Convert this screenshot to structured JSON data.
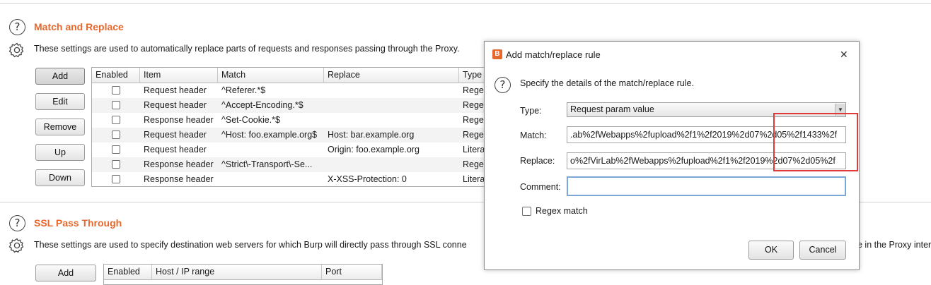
{
  "match_replace": {
    "title": "Match and Replace",
    "description": "These settings are used to automatically replace parts of requests and responses passing through the Proxy.",
    "buttons": [
      "Add",
      "Edit",
      "Remove",
      "Up",
      "Down"
    ],
    "columns": [
      "Enabled",
      "Item",
      "Match",
      "Replace",
      "Type"
    ],
    "rows": [
      {
        "enabled": false,
        "item": "Request header",
        "match": "^Referer.*$",
        "replace": "",
        "type": "Regex"
      },
      {
        "enabled": false,
        "item": "Request header",
        "match": "^Accept-Encoding.*$",
        "replace": "",
        "type": "Regex"
      },
      {
        "enabled": false,
        "item": "Response header",
        "match": "^Set-Cookie.*$",
        "replace": "",
        "type": "Regex"
      },
      {
        "enabled": false,
        "item": "Request header",
        "match": "^Host: foo.example.org$",
        "replace": "Host: bar.example.org",
        "type": "Regex"
      },
      {
        "enabled": false,
        "item": "Request header",
        "match": "",
        "replace": "Origin: foo.example.org",
        "type": "Literal"
      },
      {
        "enabled": false,
        "item": "Response header",
        "match": "^Strict\\-Transport\\-Se...",
        "replace": "",
        "type": "Regex"
      },
      {
        "enabled": false,
        "item": "Response header",
        "match": "",
        "replace": "X-XSS-Protection: 0",
        "type": "Literal"
      }
    ]
  },
  "ssl_pass_through": {
    "title": "SSL Pass Through",
    "description": "These settings are used to specify destination web servers for which Burp will directly pass through SSL conne",
    "description_tail": "e in the Proxy inter",
    "add_button": "Add",
    "columns": [
      "Enabled",
      "Host / IP range",
      "Port"
    ]
  },
  "dialog": {
    "title": "Add match/replace rule",
    "close_glyph": "✕",
    "instruction": "Specify the details of the match/replace rule.",
    "type_label": "Type:",
    "type_value": "Request param value",
    "match_label": "Match:",
    "match_value": ".ab%2fWebapps%2fupload%2f1%2f2019%2d07%2d05%2f1433%2f",
    "replace_label": "Replace:",
    "replace_value": "o%2fVirLab%2fWebapps%2fupload%2f1%2f2019%2d07%2d05%2f",
    "comment_label": "Comment:",
    "comment_value": "",
    "regex_label": "Regex match",
    "regex_checked": false,
    "ok_label": "OK",
    "cancel_label": "Cancel"
  },
  "colors": {
    "accent": "#e8672d",
    "highlight_box": "#e03a3a",
    "focus_border": "#7aa7d6"
  }
}
